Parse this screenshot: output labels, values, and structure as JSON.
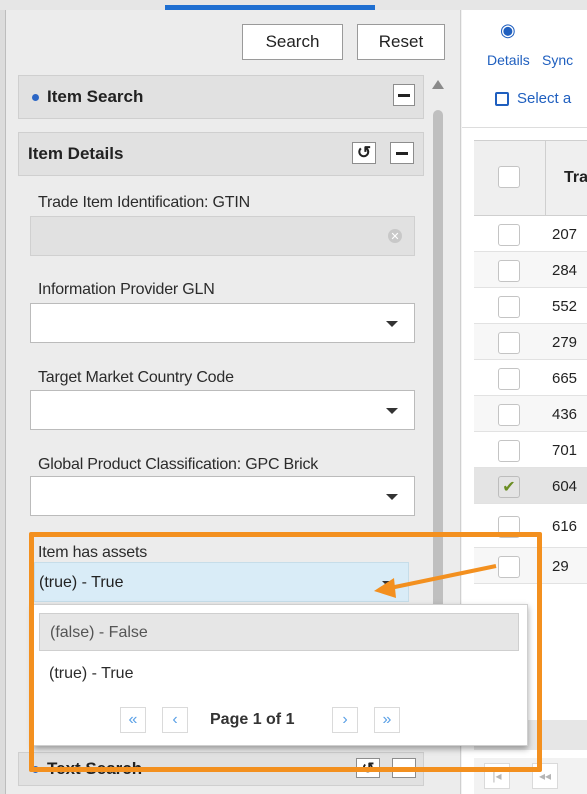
{
  "toolbar": {
    "search_label": "Search",
    "reset_label": "Reset"
  },
  "sections": {
    "item_search": {
      "title": "Item Search"
    },
    "item_details": {
      "title": "Item Details"
    },
    "text_search": {
      "title": "Text Search"
    }
  },
  "fields": {
    "gtin": {
      "label": "Trade Item Identification: GTIN",
      "value": ""
    },
    "gln": {
      "label": "Information Provider GLN",
      "value": ""
    },
    "country": {
      "label": "Target Market Country Code",
      "value": ""
    },
    "gpc": {
      "label": "Global Product Classification: GPC Brick",
      "value": ""
    },
    "assets": {
      "label": "Item has assets",
      "value": "(true) - True"
    }
  },
  "dropdown": {
    "options": [
      "(false) - False",
      "(true) - True"
    ],
    "page_label": "Page 1 of 1"
  },
  "right": {
    "details_label": "Details",
    "sync_label": "Sync",
    "select_all_label": "Select a",
    "column_header": "Tra",
    "rows": [
      "207",
      "284",
      "552",
      "279",
      "665",
      "436",
      "701",
      "604",
      "616",
      "29"
    ]
  },
  "colors": {
    "accent": "#1f6fd1",
    "highlight": "#f3901f",
    "selected_bg": "#d9ecf7"
  }
}
